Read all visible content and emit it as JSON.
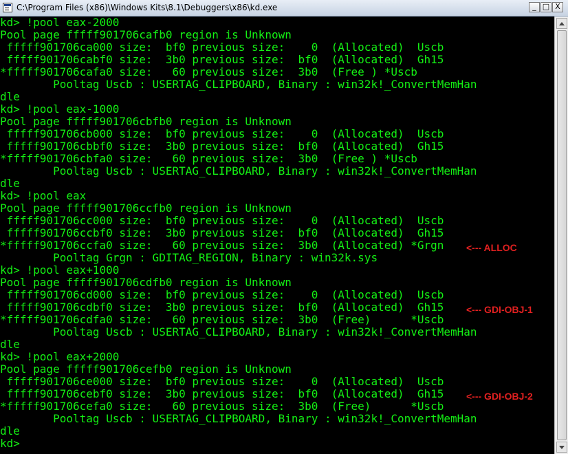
{
  "window": {
    "title": "C:\\Program Files (x86)\\Windows Kits\\8.1\\Debuggers\\x86\\kd.exe",
    "icon": "console-app-icon",
    "controls": {
      "minimize": "_",
      "maximize": "□",
      "close": "X"
    }
  },
  "console": {
    "lines": [
      "kd> !pool eax-2000",
      "Pool page fffff901706cafb0 region is Unknown",
      " fffff901706ca000 size:  bf0 previous size:    0  (Allocated)  Uscb",
      " fffff901706cabf0 size:  3b0 previous size:  bf0  (Allocated)  Gh15",
      "*fffff901706cafa0 size:   60 previous size:  3b0  (Free ) *Uscb",
      "        Pooltag Uscb : USERTAG_CLIPBOARD, Binary : win32k!_ConvertMemHan",
      "dle",
      "kd> !pool eax-1000",
      "Pool page fffff901706cbfb0 region is Unknown",
      " fffff901706cb000 size:  bf0 previous size:    0  (Allocated)  Uscb",
      " fffff901706cbbf0 size:  3b0 previous size:  bf0  (Allocated)  Gh15",
      "*fffff901706cbfa0 size:   60 previous size:  3b0  (Free ) *Uscb",
      "        Pooltag Uscb : USERTAG_CLIPBOARD, Binary : win32k!_ConvertMemHan",
      "dle",
      "kd> !pool eax",
      "Pool page fffff901706ccfb0 region is Unknown",
      " fffff901706cc000 size:  bf0 previous size:    0  (Allocated)  Uscb",
      " fffff901706ccbf0 size:  3b0 previous size:  bf0  (Allocated)  Gh15",
      "*fffff901706ccfa0 size:   60 previous size:  3b0  (Allocated) *Grgn",
      "        Pooltag Grgn : GDITAG_REGION, Binary : win32k.sys",
      "kd> !pool eax+1000",
      "Pool page fffff901706cdfb0 region is Unknown",
      " fffff901706cd000 size:  bf0 previous size:    0  (Allocated)  Uscb",
      " fffff901706cdbf0 size:  3b0 previous size:  bf0  (Allocated)  Gh15",
      "*fffff901706cdfa0 size:   60 previous size:  3b0  (Free)      *Uscb",
      "        Pooltag Uscb : USERTAG_CLIPBOARD, Binary : win32k!_ConvertMemHan",
      "dle",
      "kd> !pool eax+2000",
      "Pool page fffff901706cefb0 region is Unknown",
      " fffff901706ce000 size:  bf0 previous size:    0  (Allocated)  Uscb",
      " fffff901706cebf0 size:  3b0 previous size:  bf0  (Allocated)  Gh15",
      "*fffff901706cefa0 size:   60 previous size:  3b0  (Free)      *Uscb",
      "        Pooltag Uscb : USERTAG_CLIPBOARD, Binary : win32k!_ConvertMemHan",
      "dle",
      "kd>"
    ],
    "text_color": "#14f014",
    "background": "#000000"
  },
  "annotations": {
    "alloc": "<--- ALLOC",
    "gdi1": "<--- GDI-OBJ-1",
    "gdi2": "<--- GDI-OBJ-2",
    "color": "#e02020"
  }
}
